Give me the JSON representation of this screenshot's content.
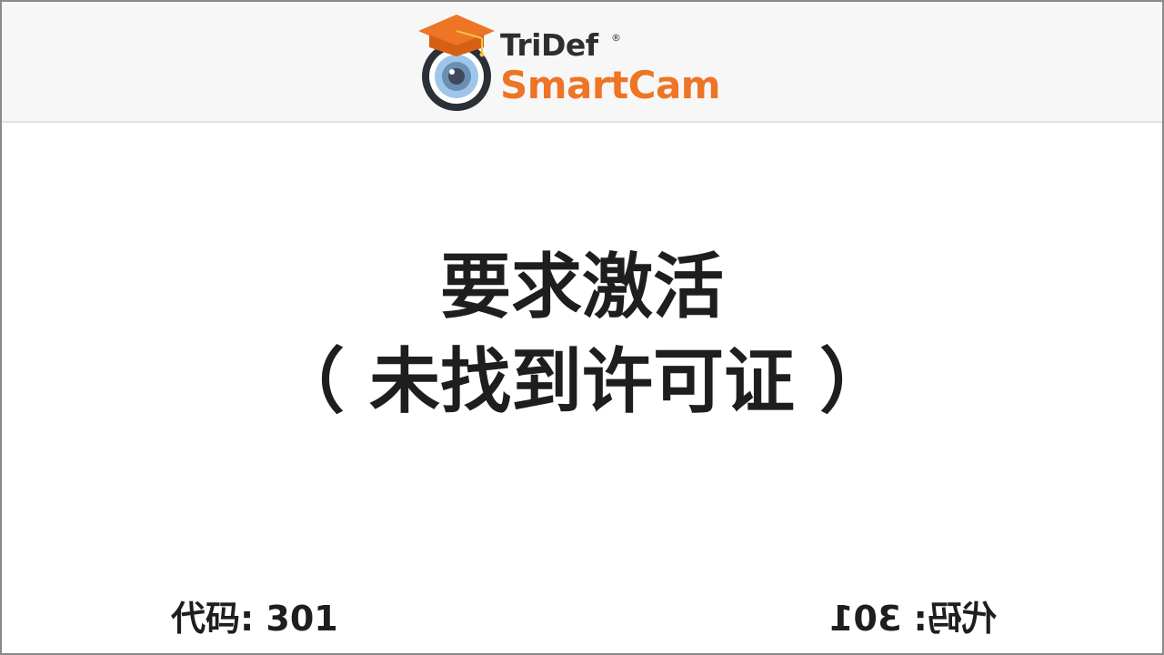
{
  "brand": {
    "line1": "TriDef",
    "registered": "®",
    "line2": "SmartCam",
    "colors": {
      "orange": "#ee7426",
      "dark": "#2e2e30"
    },
    "icon": "graduation-cap-webcam-icon"
  },
  "message": {
    "title": "要求激活",
    "subtitle": "（ 未找到许可证 ）"
  },
  "status": {
    "code_label": "代码: 301",
    "code_label_mirrored": "代码: 301"
  }
}
